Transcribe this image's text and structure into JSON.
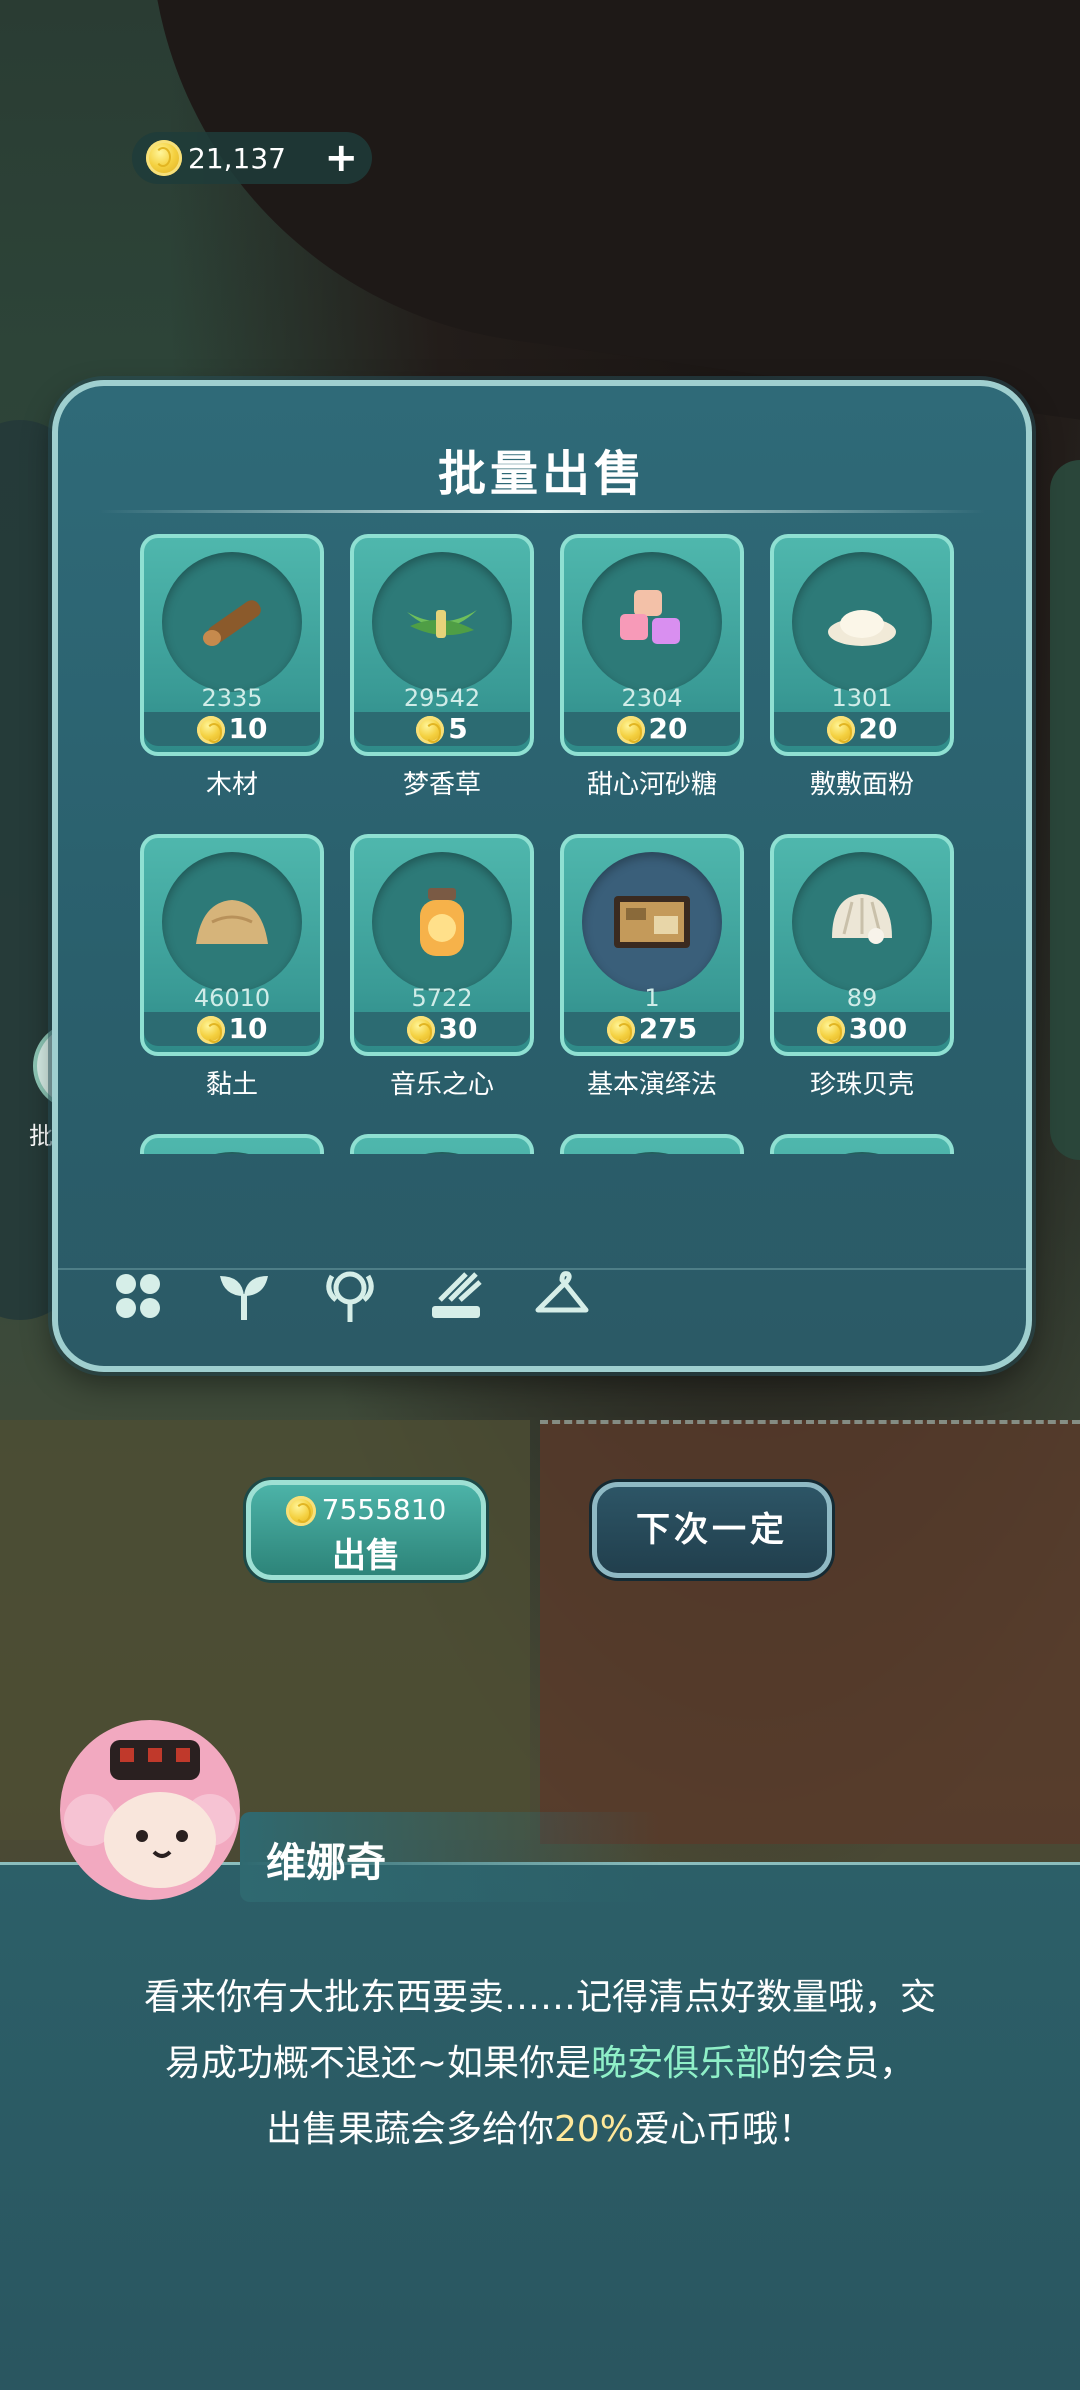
{
  "hud": {
    "coins": "21,137",
    "add_icon": "plus-icon"
  },
  "side_button": {
    "label": "批量出售",
    "icon": "shop-icon"
  },
  "panel": {
    "title": "批量出售",
    "items": [
      {
        "name": "木材",
        "quantity": "2335",
        "price": "10",
        "icon": "wood-log"
      },
      {
        "name": "梦香草",
        "quantity": "29542",
        "price": "5",
        "icon": "grass-bundle"
      },
      {
        "name": "甜心河砂糖",
        "quantity": "2304",
        "price": "20",
        "icon": "sugar-cubes"
      },
      {
        "name": "敷敷面粉",
        "quantity": "1301",
        "price": "20",
        "icon": "flour-pile"
      },
      {
        "name": "黏土",
        "quantity": "46010",
        "price": "10",
        "icon": "clay-pile"
      },
      {
        "name": "音乐之心",
        "quantity": "5722",
        "price": "30",
        "icon": "music-jar"
      },
      {
        "name": "基本演绎法",
        "quantity": "1",
        "price": "275",
        "icon": "map-book"
      },
      {
        "name": "珍珠贝壳",
        "quantity": "89",
        "price": "300",
        "icon": "pearl-shell"
      }
    ],
    "tabs": [
      "grid-icon",
      "sprout-icon",
      "flower-icon",
      "tools-icon",
      "hanger-icon"
    ]
  },
  "actions": {
    "sell_total": "7555810",
    "sell_label": "出售",
    "later_label": "下次一定"
  },
  "dialog": {
    "speaker": "维娜奇",
    "line1": "看来你有大批东西要卖……记得清点好数量哦，交",
    "line2a": "易成功概不退还~如果你是",
    "line2b": "晚安俱乐部",
    "line2c": "的会员，",
    "line3a": "出售果蔬会多给你",
    "line3b": "20%",
    "line3c": "爱心币哦！"
  },
  "colors": {
    "accent": "#4fb7ad",
    "highlight_green": "#8ff0c8",
    "highlight_yellow": "#ffe89a"
  }
}
